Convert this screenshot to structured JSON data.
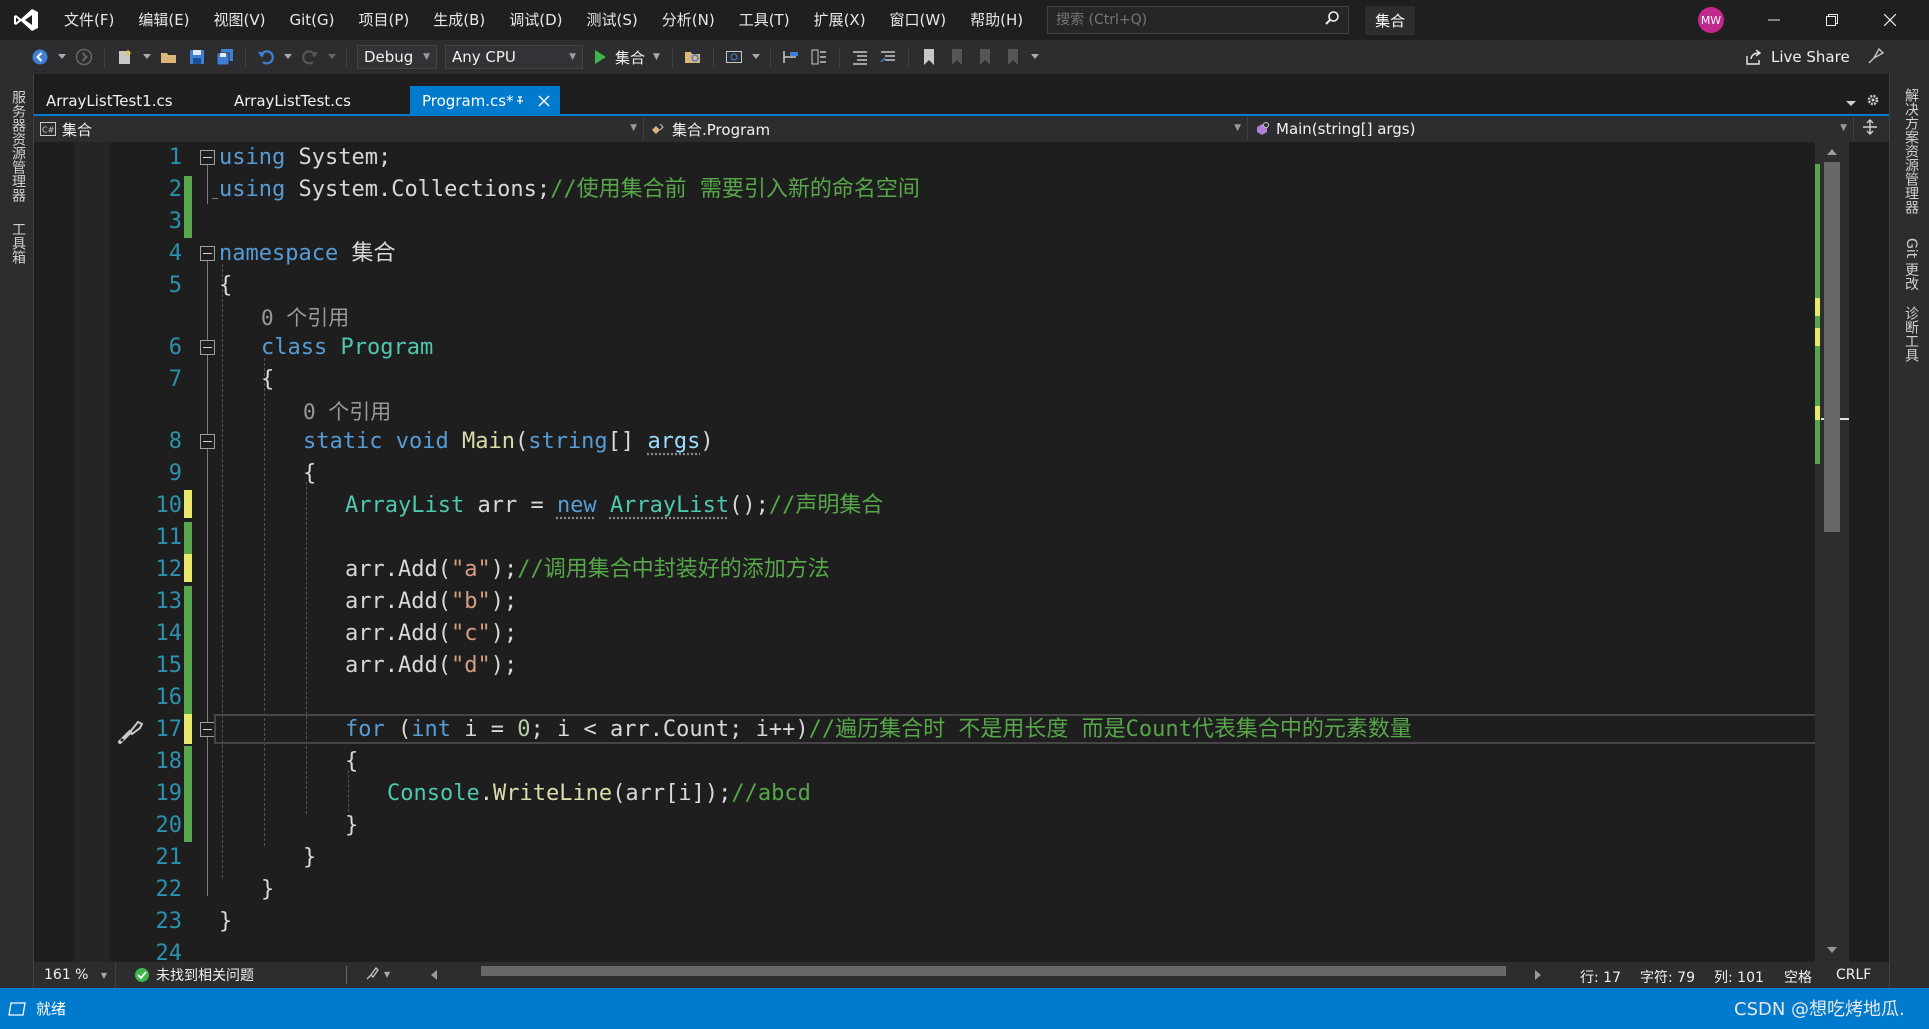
{
  "menu": {
    "items": [
      "文件(F)",
      "编辑(E)",
      "视图(V)",
      "Git(G)",
      "项目(P)",
      "生成(B)",
      "调试(D)",
      "测试(S)",
      "分析(N)",
      "工具(T)",
      "扩展(X)",
      "窗口(W)",
      "帮助(H)"
    ],
    "search_placeholder": "搜索 (Ctrl+Q)",
    "solution_name": "集合",
    "avatar_initials": "MW"
  },
  "toolbar": {
    "configuration": "Debug",
    "platform": "Any CPU",
    "start_label": "集合",
    "live_share": "Live Share"
  },
  "left_rail": {
    "tabs": [
      "服务器资源管理器",
      "工具箱"
    ]
  },
  "right_rail": {
    "tabs": [
      "解决方案资源管理器",
      "Git 更改",
      "诊断工具"
    ]
  },
  "tabs": [
    {
      "label": "ArrayListTest1.cs",
      "active": false
    },
    {
      "label": "ArrayListTest.cs",
      "active": false
    },
    {
      "label": "Program.cs*",
      "active": true
    }
  ],
  "navigation": {
    "project": "集合",
    "type": "集合.Program",
    "member": "Main(string[] args)"
  },
  "editor": {
    "lens_text": "0 个引用",
    "line_numbers": [
      "1",
      "2",
      "3",
      "4",
      "5",
      "6",
      "7",
      "8",
      "9",
      "10",
      "11",
      "12",
      "13",
      "14",
      "15",
      "16",
      "17",
      "18",
      "19",
      "20",
      "21",
      "22",
      "23",
      "24"
    ],
    "code": {
      "l1": [
        "using",
        " System;"
      ],
      "l2": [
        "using",
        " System.Collections;",
        "//使用集合前 需要引入新的命名空间"
      ],
      "l4": [
        "namespace",
        " 集合"
      ],
      "l5": "{",
      "l6": [
        "class",
        " ",
        "Program"
      ],
      "l7": "{",
      "l8": [
        "static",
        " ",
        "void",
        " ",
        "Main",
        "(",
        "string",
        "[] ",
        "args",
        ")"
      ],
      "l9": "{",
      "l10": [
        "ArrayList",
        " arr = ",
        "new",
        " ",
        "ArrayList",
        "();",
        "//声明集合"
      ],
      "l12": [
        "arr.Add(",
        "\"a\"",
        ");",
        "//调用集合中封装好的添加方法"
      ],
      "l13": [
        "arr.Add(",
        "\"b\"",
        ");"
      ],
      "l14": [
        "arr.Add(",
        "\"c\"",
        ");"
      ],
      "l15": [
        "arr.Add(",
        "\"d\"",
        ");"
      ],
      "l17": [
        "for",
        " (",
        "int",
        " i = ",
        "0",
        "; i < arr.Count; i++)",
        "//遍历集合时 不是用长度 而是Count代表集合中的元素数量"
      ],
      "l18": "{",
      "l19": [
        "Console",
        ".",
        "WriteLine",
        "(arr[i]);",
        "//abcd"
      ],
      "l20": "}",
      "l21": "}",
      "l22": "}",
      "l23": "}"
    }
  },
  "editor_status": {
    "zoom": "161 %",
    "issues": "未找到相关问题",
    "line": "行: 17",
    "char": "字符: 79",
    "col": "列: 101",
    "whitespace": "空格",
    "line_ending": "CRLF"
  },
  "statusbar": {
    "ready": "就绪",
    "watermark": "CSDN @想吃烤地瓜."
  },
  "colors": {
    "accent": "#007acc",
    "keyword": "#569cd6",
    "type": "#4ec9b0",
    "comment": "#57a64a",
    "string": "#d69d85",
    "line_number": "#2b91af"
  }
}
